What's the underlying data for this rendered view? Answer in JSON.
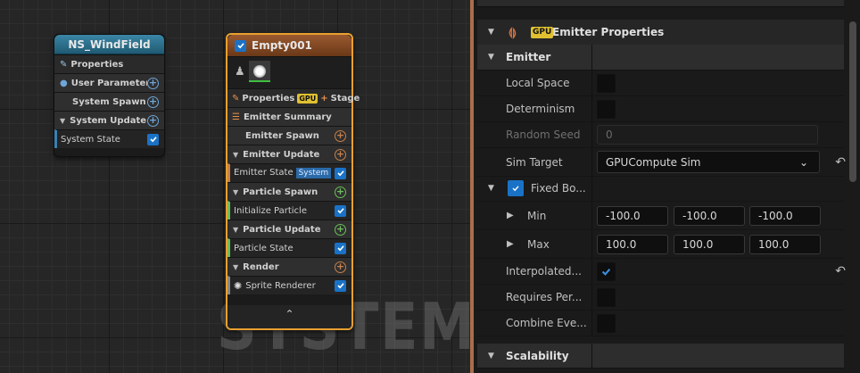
{
  "graph": {
    "watermark": "SYSTEM",
    "system_node": {
      "title": "NS_WindField",
      "rows": {
        "properties": "Properties",
        "user_parameters": "User Parameters",
        "system_spawn": "System Spawn",
        "system_update": "System Update",
        "system_state": "System State"
      }
    },
    "emitter_node": {
      "title": "Empty001",
      "properties": "Properties",
      "gpu_badge": "GPU",
      "stage": "Stage",
      "emitter_summary": "Emitter Summary",
      "emitter_spawn": "Emitter Spawn",
      "emitter_update": "Emitter Update",
      "emitter_state": "Emitter State",
      "system_badge": "System",
      "particle_spawn": "Particle Spawn",
      "initialize_particle": "Initialize Particle",
      "particle_update": "Particle Update",
      "particle_state": "Particle State",
      "render": "Render",
      "sprite_renderer": "Sprite Renderer"
    }
  },
  "panel": {
    "section_title": "Emitter Properties",
    "gpu_badge": "GPU",
    "emitter_category": "Emitter",
    "local_space": "Local Space",
    "determinism": "Determinism",
    "random_seed": "Random Seed",
    "random_seed_value": "0",
    "sim_target": "Sim Target",
    "sim_target_value": "GPUCompute Sim",
    "fixed_bounds": "Fixed Bo...",
    "min": "Min",
    "min_x": "-100.0",
    "min_y": "-100.0",
    "min_z": "-100.0",
    "max": "Max",
    "max_x": "100.0",
    "max_y": "100.0",
    "max_z": "100.0",
    "interpolated": "Interpolated...",
    "requires_per": "Requires Per...",
    "combine_eve": "Combine Eve...",
    "scalability": "Scalability"
  },
  "colors": {
    "system_title": "#2a6a86",
    "emitter_title": "#8a4e2a",
    "emitter_border": "#e8a030",
    "accent_checkbox": "#1a72c7"
  }
}
